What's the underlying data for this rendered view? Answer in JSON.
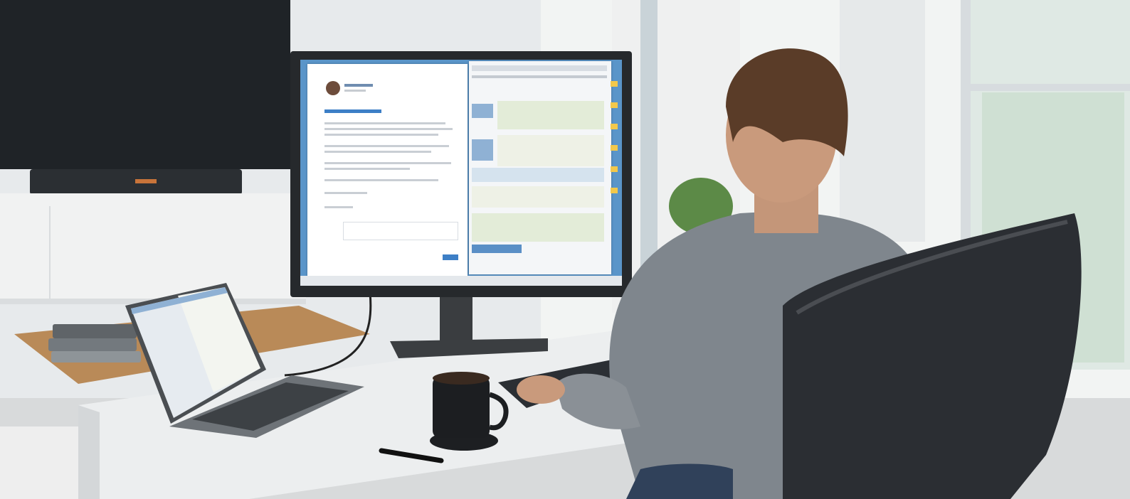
{
  "scene": {
    "description_elements": [
      "monitor",
      "laptop",
      "desk",
      "coffee-mug",
      "keyboard",
      "office-chair",
      "person",
      "window",
      "tv"
    ],
    "monitor_brand_mark": "",
    "colors": {
      "wall": "#e9ecee",
      "tv": "#1f2327",
      "desk_top": "#eceeef",
      "shelf_wood": "#b98a58",
      "monitor_bezel": "#26292c",
      "screen_blue": "#5a95c9",
      "shirt": "#7f868d",
      "hair": "#5a3c28",
      "chair": "#2b2e33",
      "window_light": "#f3f6f5",
      "plant": "#5c8a47"
    }
  }
}
